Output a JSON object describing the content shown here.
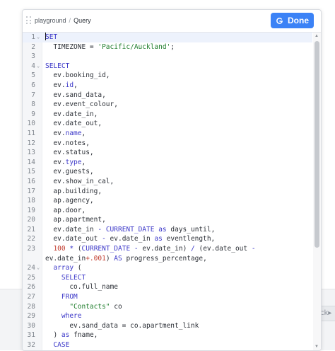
{
  "breadcrumb": {
    "parent": "playground",
    "separator": "/",
    "current": "Query"
  },
  "done_button": {
    "label": "Done"
  },
  "background": {
    "partial_label": "ck"
  },
  "colors": {
    "accent": "#3b82f6",
    "keyword": "#3a36c8",
    "string": "#1e7d2b",
    "number": "#c0392b"
  },
  "editor": {
    "active_line": 1,
    "lines": [
      {
        "n": "1",
        "fold": true,
        "tokens": [
          {
            "t": "SET",
            "c": "kw"
          }
        ]
      },
      {
        "n": "2",
        "tokens": [
          {
            "t": "  TIMEZONE = "
          },
          {
            "t": "'Pacific/Auckland'",
            "c": "str"
          },
          {
            "t": ";"
          }
        ]
      },
      {
        "n": "3",
        "tokens": []
      },
      {
        "n": "4",
        "fold": true,
        "tokens": [
          {
            "t": "SELECT",
            "c": "kw"
          }
        ]
      },
      {
        "n": "5",
        "tokens": [
          {
            "t": "  ev.booking_id,"
          }
        ]
      },
      {
        "n": "6",
        "tokens": [
          {
            "t": "  ev."
          },
          {
            "t": "id",
            "c": "kw"
          },
          {
            "t": ","
          }
        ]
      },
      {
        "n": "7",
        "tokens": [
          {
            "t": "  ev.sand_data,"
          }
        ]
      },
      {
        "n": "8",
        "tokens": [
          {
            "t": "  ev.event_colour,"
          }
        ]
      },
      {
        "n": "9",
        "tokens": [
          {
            "t": "  ev.date_in,"
          }
        ]
      },
      {
        "n": "10",
        "tokens": [
          {
            "t": "  ev.date_out,"
          }
        ]
      },
      {
        "n": "11",
        "tokens": [
          {
            "t": "  ev."
          },
          {
            "t": "name",
            "c": "kw"
          },
          {
            "t": ","
          }
        ]
      },
      {
        "n": "12",
        "tokens": [
          {
            "t": "  ev.notes,"
          }
        ]
      },
      {
        "n": "13",
        "tokens": [
          {
            "t": "  ev.status,"
          }
        ]
      },
      {
        "n": "14",
        "tokens": [
          {
            "t": "  ev."
          },
          {
            "t": "type",
            "c": "kw"
          },
          {
            "t": ","
          }
        ]
      },
      {
        "n": "15",
        "tokens": [
          {
            "t": "  ev.guests,"
          }
        ]
      },
      {
        "n": "16",
        "tokens": [
          {
            "t": "  ev.show_in_cal,"
          }
        ]
      },
      {
        "n": "17",
        "tokens": [
          {
            "t": "  ap.building,"
          }
        ]
      },
      {
        "n": "18",
        "tokens": [
          {
            "t": "  ap.agency,"
          }
        ]
      },
      {
        "n": "19",
        "tokens": [
          {
            "t": "  ap.door,"
          }
        ]
      },
      {
        "n": "20",
        "tokens": [
          {
            "t": "  ap.apartment,"
          }
        ]
      },
      {
        "n": "21",
        "tokens": [
          {
            "t": "  ev.date_in "
          },
          {
            "t": "-",
            "c": "kw"
          },
          {
            "t": " "
          },
          {
            "t": "CURRENT_DATE",
            "c": "kw"
          },
          {
            "t": " "
          },
          {
            "t": "as",
            "c": "kw"
          },
          {
            "t": " days_until,"
          }
        ]
      },
      {
        "n": "22",
        "tokens": [
          {
            "t": "  ev.date_out "
          },
          {
            "t": "-",
            "c": "kw"
          },
          {
            "t": " ev.date_in "
          },
          {
            "t": "as",
            "c": "kw"
          },
          {
            "t": " eventlength,"
          }
        ]
      },
      {
        "n": "23",
        "wrap": true,
        "tokens": [
          {
            "t": "  "
          },
          {
            "t": "100",
            "c": "num"
          },
          {
            "t": " "
          },
          {
            "t": "*",
            "c": "kw"
          },
          {
            "t": " ("
          },
          {
            "t": "CURRENT_DATE",
            "c": "kw"
          },
          {
            "t": " "
          },
          {
            "t": "-",
            "c": "kw"
          },
          {
            "t": " ev.date_in) "
          },
          {
            "t": "/",
            "c": "kw"
          },
          {
            "t": " (ev.date_out "
          },
          {
            "t": "-",
            "c": "kw"
          },
          {
            "t": "\nev.date_in"
          },
          {
            "t": "+.001",
            "c": "num"
          },
          {
            "t": ") "
          },
          {
            "t": "AS",
            "c": "kw"
          },
          {
            "t": " progress_percentage,"
          }
        ]
      },
      {
        "n": "24",
        "fold": true,
        "tokens": [
          {
            "t": "  "
          },
          {
            "t": "array",
            "c": "kw"
          },
          {
            "t": " ("
          }
        ]
      },
      {
        "n": "25",
        "tokens": [
          {
            "t": "    "
          },
          {
            "t": "SELECT",
            "c": "kw"
          }
        ]
      },
      {
        "n": "26",
        "tokens": [
          {
            "t": "      co.full_name"
          }
        ]
      },
      {
        "n": "27",
        "tokens": [
          {
            "t": "    "
          },
          {
            "t": "FROM",
            "c": "kw"
          }
        ]
      },
      {
        "n": "28",
        "tokens": [
          {
            "t": "      "
          },
          {
            "t": "\"Contacts\"",
            "c": "str"
          },
          {
            "t": " co"
          }
        ]
      },
      {
        "n": "29",
        "tokens": [
          {
            "t": "    "
          },
          {
            "t": "where",
            "c": "kw"
          }
        ]
      },
      {
        "n": "30",
        "tokens": [
          {
            "t": "      ev.sand_data = co.apartment_link"
          }
        ]
      },
      {
        "n": "31",
        "tokens": [
          {
            "t": "  ) "
          },
          {
            "t": "as",
            "c": "kw"
          },
          {
            "t": " fname,"
          }
        ]
      },
      {
        "n": "32",
        "tokens": [
          {
            "t": "  "
          },
          {
            "t": "CASE",
            "c": "kw"
          }
        ]
      }
    ]
  }
}
